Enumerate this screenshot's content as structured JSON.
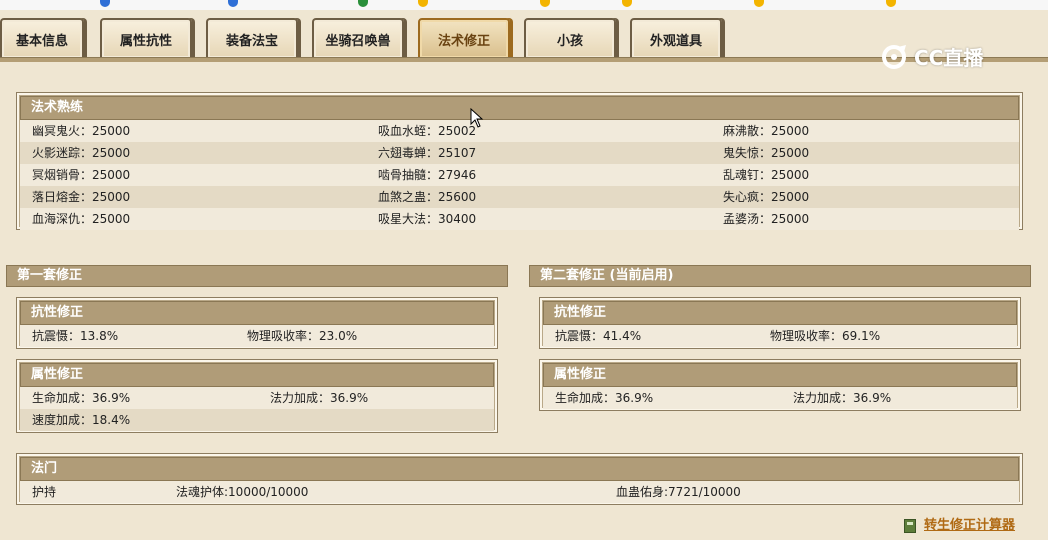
{
  "tabs": [
    {
      "label": "基本信息"
    },
    {
      "label": "属性抗性"
    },
    {
      "label": "装备法宝"
    },
    {
      "label": "坐骑召唤兽"
    },
    {
      "label": "法术修正"
    },
    {
      "label": "小孩"
    },
    {
      "label": "外观道具"
    }
  ],
  "active_tab": "法术修正",
  "logo_text": "CC直播",
  "mastery": {
    "title": "法术熟练",
    "rows": [
      [
        "幽冥鬼火：25000",
        "吸血水蛭：25002",
        "麻沸散：25000"
      ],
      [
        "火影迷踪：25000",
        "六翅毒蝉：25107",
        "鬼失惊：25000"
      ],
      [
        "冥烟销骨：25000",
        "啮骨抽髓：27946",
        "乱魂钉：25000"
      ],
      [
        "落日熔金：25000",
        "血煞之蛊：25600",
        "失心疯：25000"
      ],
      [
        "血海深仇：25000",
        "吸星大法：30400",
        "孟婆汤：25000"
      ]
    ]
  },
  "set1": {
    "title": "第一套修正",
    "resist": {
      "title": "抗性修正",
      "items": [
        "抗震慑：13.8%",
        "物理吸收率：23.0%"
      ]
    },
    "attr": {
      "title": "属性修正",
      "items": [
        "生命加成：36.9%",
        "法力加成：36.9%",
        "速度加成：18.4%"
      ]
    }
  },
  "set2": {
    "title": "第二套修正 (当前启用)",
    "resist": {
      "title": "抗性修正",
      "items": [
        "抗震慑：41.4%",
        "物理吸收率：69.1%"
      ]
    },
    "attr": {
      "title": "属性修正",
      "items": [
        "生命加成：36.9%",
        "法力加成：36.9%"
      ]
    }
  },
  "fa_men": {
    "title": "法门",
    "items": [
      "护持",
      "法魂护体:10000/10000",
      "血蛊佑身:7721/10000"
    ]
  },
  "footer_link": "转生修正计算器",
  "colors": {
    "background": "#efe6d2",
    "header": "#b09c78",
    "active_tab_border": "#9c6a1f",
    "link": "#b06a14"
  }
}
